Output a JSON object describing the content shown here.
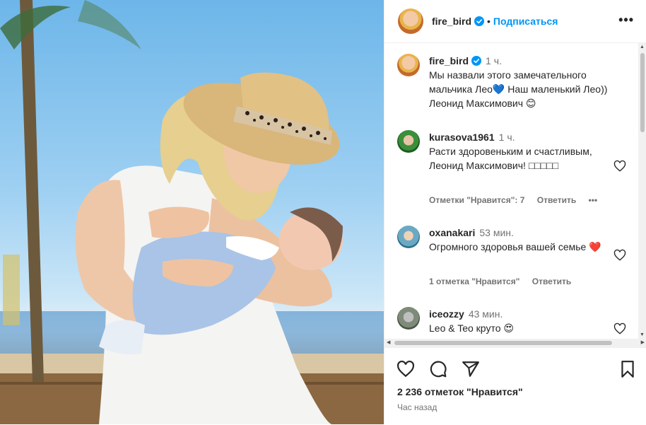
{
  "post": {
    "author": "fire_bird",
    "follow_label": "Подписаться",
    "dot": "•",
    "more": "•••"
  },
  "caption": {
    "user": "fire_bird",
    "time": "1 ч.",
    "text": "Мы назвали этого замечательного мальчика Лео💙 Наш маленький Лео)) Леонид Максимович 😊"
  },
  "comments": [
    {
      "user": "kurasova1961",
      "time": "1 ч.",
      "text": "Расти здоровеньким и счастливым, Леонид Максимович! □□□□□",
      "likes": "Отметки \"Нравится\": 7",
      "reply": "Ответить",
      "more": "•••"
    },
    {
      "user": "oxanakari",
      "time": "53 мин.",
      "text": "Огромного здоровья вашей семье ❤️",
      "likes": "1 отметка \"Нравится\"",
      "reply": "Ответить"
    },
    {
      "user": "iceozzy",
      "time": "43 мин.",
      "text": "Leo & Teo круто 😍"
    }
  ],
  "footer": {
    "likes": "2 236 отметок \"Нравится\"",
    "posted": "Час назад"
  },
  "colors": {
    "accent": "#0095f6",
    "muted": "#737373",
    "text": "#262626"
  }
}
